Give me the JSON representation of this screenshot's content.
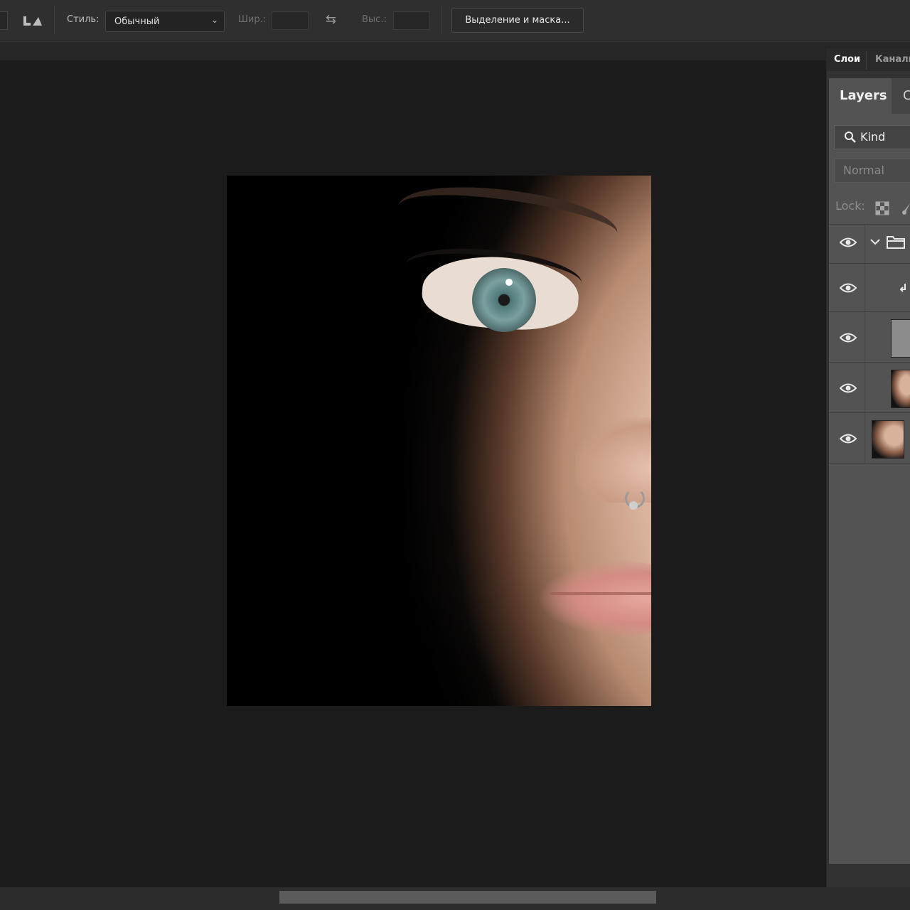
{
  "options_bar": {
    "style_label": "Стиль:",
    "style_value": "Обычный",
    "width_label": "Шир.:",
    "height_label": "Выс.:",
    "select_mask_button": "Выделение и маска..."
  },
  "right_panel": {
    "tabs": [
      {
        "label": "Слои",
        "active": true
      },
      {
        "label": "Каналы",
        "active": false
      }
    ],
    "layers_panel": {
      "tab_label": "Layers",
      "second_tab_partial": "C",
      "filter_kind": "Kind",
      "blend_mode": "Normal",
      "lock_label": "Lock:",
      "layers": [
        {
          "type": "group",
          "visible": true,
          "expanded": true
        },
        {
          "type": "clipped-adjustment",
          "visible": true
        },
        {
          "type": "gray-fill",
          "visible": true
        },
        {
          "type": "photo",
          "visible": true
        },
        {
          "type": "photo",
          "visible": true
        }
      ]
    }
  },
  "colors": {
    "app_bg": "#1b1b1b",
    "panel_bg": "#535353",
    "options_bar_bg": "#2f2f2f"
  }
}
